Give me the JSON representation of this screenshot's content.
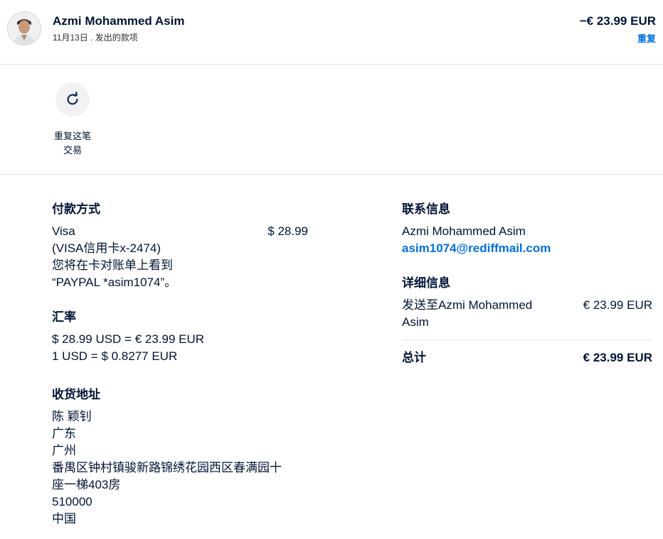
{
  "header": {
    "name": "Azmi Mohammed Asim",
    "subline": "11月13日 . 发出的款项",
    "amount": "−€ 23.99 EUR",
    "repeat_link": "重复"
  },
  "action": {
    "label_line1": "重复这笔",
    "label_line2": "交易",
    "icon": "refresh-icon"
  },
  "payment": {
    "title": "付款方式",
    "method": "Visa",
    "amount": "$ 28.99",
    "lines": [
      "(VISA信用卡x-2474)",
      "您将在卡对账单上看到",
      "“PAYPAL *asim1074”。"
    ]
  },
  "exchange": {
    "title": "汇率",
    "line1": "$ 28.99 USD = € 23.99 EUR",
    "line2": "1 USD = $ 0.8277 EUR"
  },
  "shipping": {
    "title": "收货地址",
    "lines": [
      "陈 颖钊",
      "广东",
      "广州",
      "番禺区钟村镇骏新路锦绣花园西区春满园十",
      "座一梯403房",
      "510000",
      "中国"
    ]
  },
  "contact": {
    "title": "联系信息",
    "name": "Azmi Mohammed Asim",
    "email": "asim1074@rediffmail.com"
  },
  "details": {
    "title": "详细信息",
    "item_line1": "发送至Azmi Mohammed",
    "item_line2": "Asim",
    "item_amount": "€ 23.99 EUR",
    "total_label": "总计",
    "total_amount": "€ 23.99 EUR"
  },
  "colors": {
    "text": "#001435",
    "link": "#0070e0",
    "divider": "#e3e3e3",
    "icon_bg": "#f2f2f2"
  }
}
